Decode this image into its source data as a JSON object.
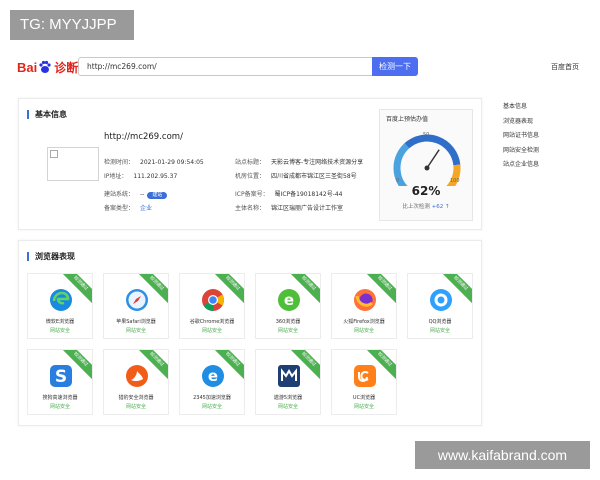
{
  "overlay_tag": "TG: MYYJJPP",
  "watermark": "www.kaifabrand.com",
  "header": {
    "logo_text_bai": "Bai",
    "logo_text_yi": "诊断",
    "search_value": "http://mc269.com/",
    "search_button": "检测一下",
    "home_link": "百度首页"
  },
  "basic_info": {
    "section_title": "基本信息",
    "url": "http://mc269.com/",
    "fields_left": [
      {
        "label": "检测时间：",
        "value": "2021-01-29 09:54:05"
      },
      {
        "label": "IP地址：",
        "value": "111.202.95.37"
      }
    ],
    "fields_right": [
      {
        "label": "站点标题：",
        "value": "天影云博客-专注网络技术资源分享"
      },
      {
        "label": "机房位置：",
        "value": "四川省成都市锦江区三圣街58号"
      }
    ],
    "build_label": "建站系统：",
    "build_value": "--",
    "build_badge": "建站",
    "biz_label": "备案类型：",
    "biz_value": "企业",
    "icp_label": "ICP备案号：",
    "icp_value": "蜀ICP备19018142号-44",
    "owner_label": "主体名称：",
    "owner_value": "锦江区瑞丽广告设计工作室"
  },
  "weight_card": {
    "title": "百度上预估办值",
    "percent": "62%",
    "percent_value": 62,
    "compare_label": "比上次检测",
    "compare_value": "+62 ↑",
    "ticks": [
      "0",
      "50",
      "100"
    ]
  },
  "side_nav": [
    "基本信息",
    "浏览器表现",
    "网站证书信息",
    "网站安全检测",
    "站点企业信息"
  ],
  "browsers": {
    "section_title": "浏览器表现",
    "ribbon": "检测通过",
    "safe_label": "网站安全",
    "items": [
      {
        "name": "微软E浏览器",
        "icon": "edge-icon"
      },
      {
        "name": "苹果Safari浏览器",
        "icon": "safari-icon"
      },
      {
        "name": "谷歌Chrome浏览器",
        "icon": "chrome-icon"
      },
      {
        "name": "360浏览器",
        "icon": "360-browser-icon"
      },
      {
        "name": "火狐Firefox浏览器",
        "icon": "firefox-icon"
      },
      {
        "name": "QQ浏览器",
        "icon": "qq-browser-icon"
      },
      {
        "name": "搜狗高速浏览器",
        "icon": "sogou-icon"
      },
      {
        "name": "猎豹安全浏览器",
        "icon": "liebao-icon"
      },
      {
        "name": "2345加速浏览器",
        "icon": "2345-browser-icon"
      },
      {
        "name": "遨游5浏览器",
        "icon": "maxthon-icon"
      },
      {
        "name": "UC浏览器",
        "icon": "uc-browser-icon"
      }
    ]
  },
  "colors": {
    "accent": "#3a6fd8",
    "search_button": "#4e6ef2",
    "safe_green": "#4caf50",
    "logo_red": "#e1251b"
  }
}
